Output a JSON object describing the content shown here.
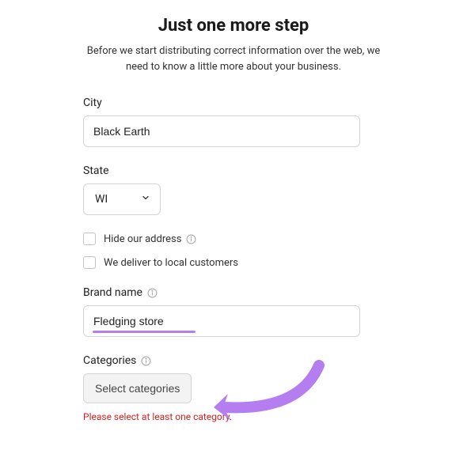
{
  "header": {
    "title": "Just one more step",
    "subtitle": "Before we start distributing correct information over the web, we need to know a little more about your business."
  },
  "city": {
    "label": "City",
    "value": "Black Earth"
  },
  "state": {
    "label": "State",
    "value": "WI"
  },
  "checkboxes": {
    "hide_address": "Hide our address",
    "deliver_local": "We deliver to local customers"
  },
  "brand": {
    "label": "Brand name",
    "value": "Fledging store"
  },
  "categories": {
    "label": "Categories",
    "button": "Select categories",
    "error": "Please select at least one category."
  },
  "colors": {
    "accent": "#b57ef0",
    "error": "#d61f1f"
  }
}
